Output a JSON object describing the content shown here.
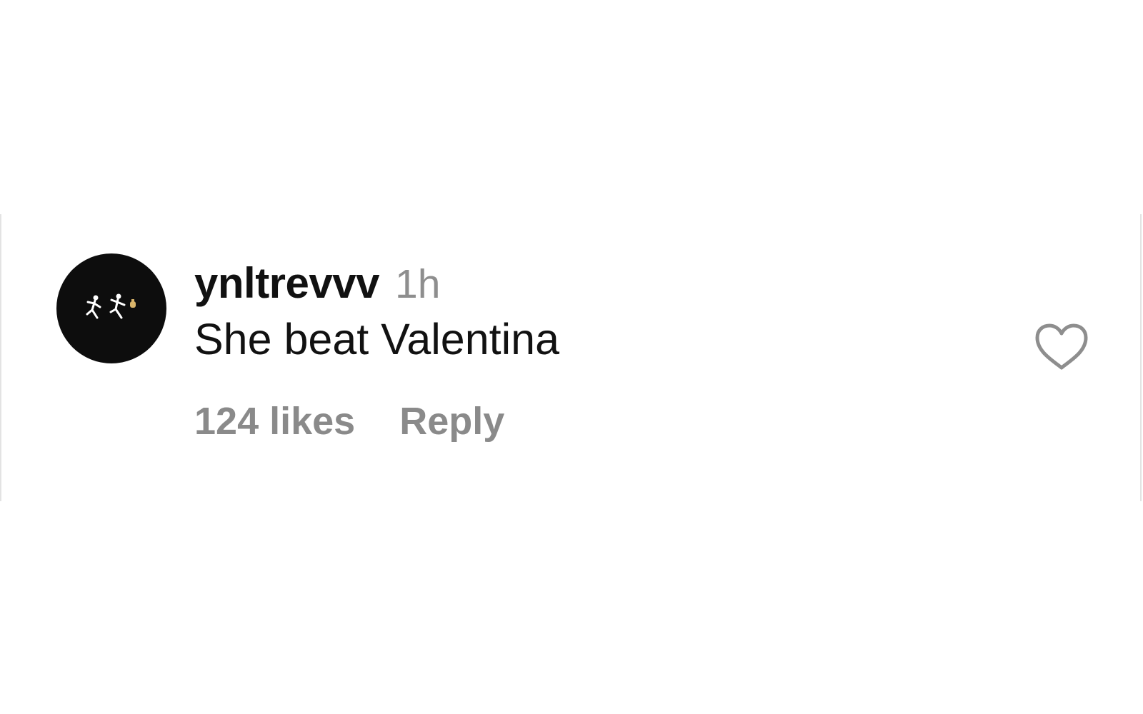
{
  "comment": {
    "username": "ynltrevvv",
    "timestamp": "1h",
    "text": "She beat Valentina",
    "likes_label": "124 likes",
    "reply_label": "Reply",
    "avatar_icon": "running-figures-icon",
    "like_icon": "heart-outline-icon"
  },
  "colors": {
    "text_primary": "#111111",
    "text_secondary": "#8e8e8e",
    "avatar_bg": "#0d0d0d",
    "heart_stroke": "#8e8e8e"
  }
}
